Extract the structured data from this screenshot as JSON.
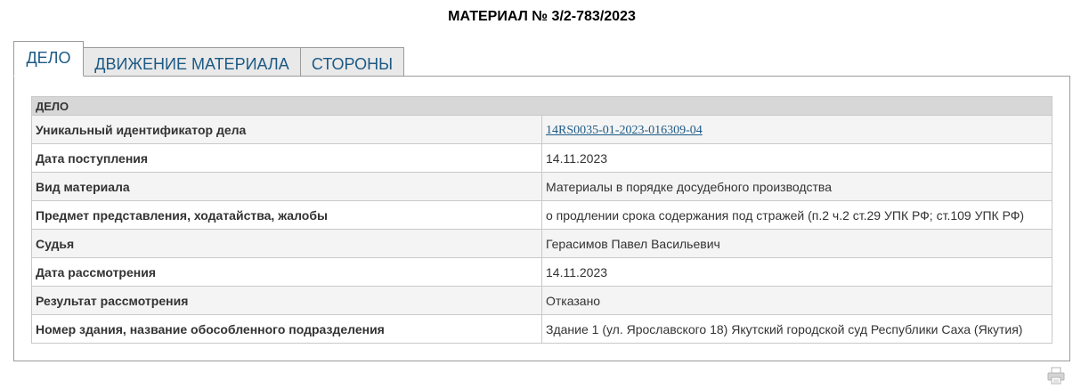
{
  "page": {
    "title": "МАТЕРИАЛ № 3/2-783/2023"
  },
  "tabs": [
    {
      "label": "ДЕЛО"
    },
    {
      "label": "ДВИЖЕНИЕ МАТЕРИАЛА"
    },
    {
      "label": "СТОРОНЫ"
    }
  ],
  "case_table": {
    "section_title": "ДЕЛО",
    "rows": [
      {
        "label": "Уникальный идентификатор дела",
        "value": "14RS0035-01-2023-016309-04"
      },
      {
        "label": "Дата поступления",
        "value": "14.11.2023"
      },
      {
        "label": "Вид материала",
        "value": "Материалы в порядке досудебного производства"
      },
      {
        "label": "Предмет представления, ходатайства, жалобы",
        "value": "о продлении срока содержания под стражей (п.2 ч.2 ст.29 УПК РФ; ст.109 УПК РФ)"
      },
      {
        "label": "Судья",
        "value": "Герасимов Павел Васильевич"
      },
      {
        "label": "Дата рассмотрения",
        "value": "14.11.2023"
      },
      {
        "label": "Результат рассмотрения",
        "value": "Отказано"
      },
      {
        "label": "Номер здания, название обособленного подразделения",
        "value": "Здание 1 (ул. Ярославского 18) Якутский городской суд Республики Саха (Якутия)"
      }
    ]
  },
  "colors": {
    "accent": "#1c5a85",
    "header_bg": "#d7d7d7",
    "row_alt_bg": "#f4f4f4",
    "border": "#9a9a9a"
  },
  "icons": {
    "print": "printer-icon"
  }
}
